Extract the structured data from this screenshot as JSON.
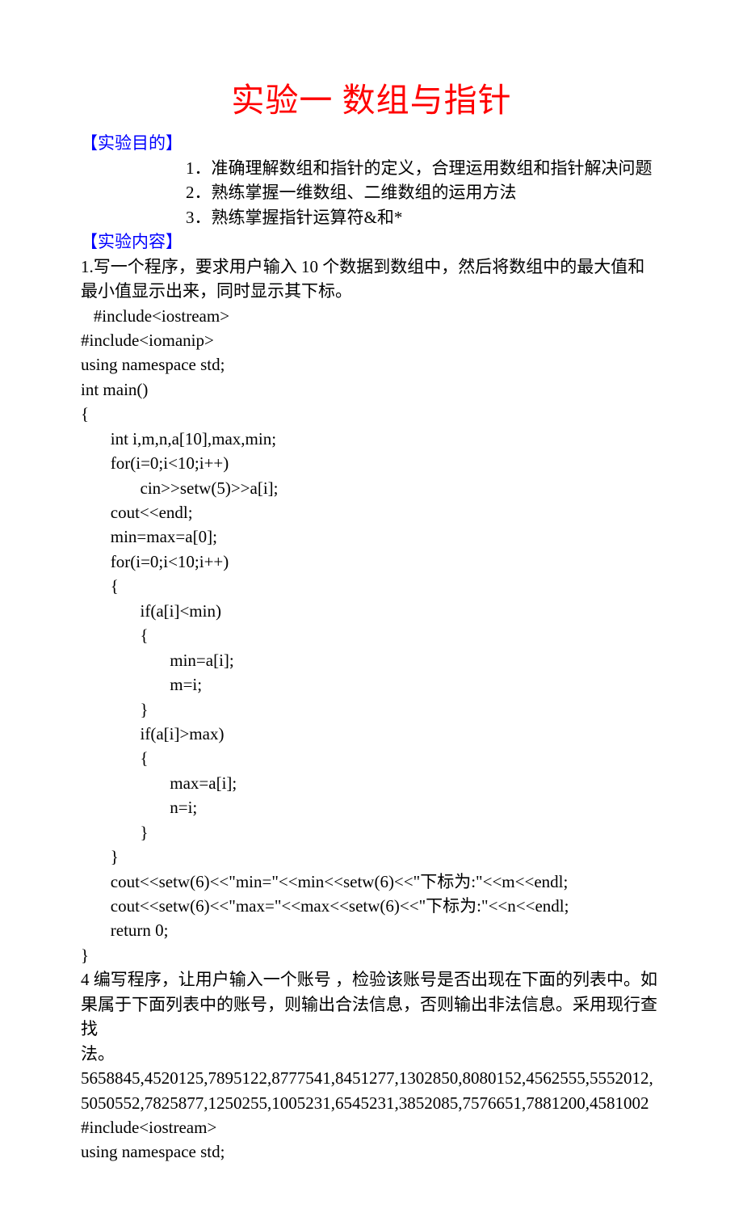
{
  "title": "实验一   数组与指针",
  "section1": {
    "header": "【实验目的】",
    "items": [
      "1．准确理解数组和指针的定义，合理运用数组和指针解决问题",
      "2．熟练掌握一维数组、二维数组的运用方法",
      "3．熟练掌握指针运算符&和*"
    ]
  },
  "section2": {
    "header": "【实验内容】",
    "problem1_desc_a": "   1.写一个程序，要求用户输入 10 个数据到数组中，然后将数组中的最大值和",
    "problem1_desc_b": "最小值显示出来，同时显示其下标。",
    "code1": [
      "   #include<iostream>",
      "#include<iomanip>",
      "using namespace std;",
      "int main()",
      "{",
      "       int i,m,n,a[10],max,min;",
      "       for(i=0;i<10;i++)",
      "              cin>>setw(5)>>a[i];",
      "       cout<<endl;",
      "       min=max=a[0];",
      "       for(i=0;i<10;i++)",
      "       {",
      "              if(a[i]<min)",
      "              {",
      "                     min=a[i];",
      "                     m=i;",
      "              }",
      "              if(a[i]>max)",
      "              {",
      "                     max=a[i];",
      "                     n=i;",
      "              }",
      "       }"
    ],
    "code1_out1_a": "       cout<<setw(6)<<\"min=\"<<min<<setw(6)<<\"",
    "code1_out1_b": "下标为",
    "code1_out1_c": ":\"<<m<<endl;",
    "code1_out2_a": "       cout<<setw(6)<<\"max=\"<<max<<setw(6)<<\"",
    "code1_out2_b": "下标为",
    "code1_out2_c": ":\"<<n<<endl;",
    "code1_tail": [
      "       return 0;",
      "",
      "}"
    ],
    "problem4_a": "4 编写程序，让用户输入一个账号 ，检验该账号是否出现在下面的列表中。如",
    "problem4_b": "果属于下面列表中的账号，则输出合法信息，否则输出非法信息。采用现行查找",
    "problem4_c": "法。",
    "numbers1": "5658845,4520125,7895122,8777541,8451277,1302850,8080152,4562555,5552012,",
    "numbers2": "5050552,7825877,1250255,1005231,6545231,3852085,7576651,7881200,4581002",
    "code2": [
      "#include<iostream>",
      "using namespace std;"
    ]
  }
}
